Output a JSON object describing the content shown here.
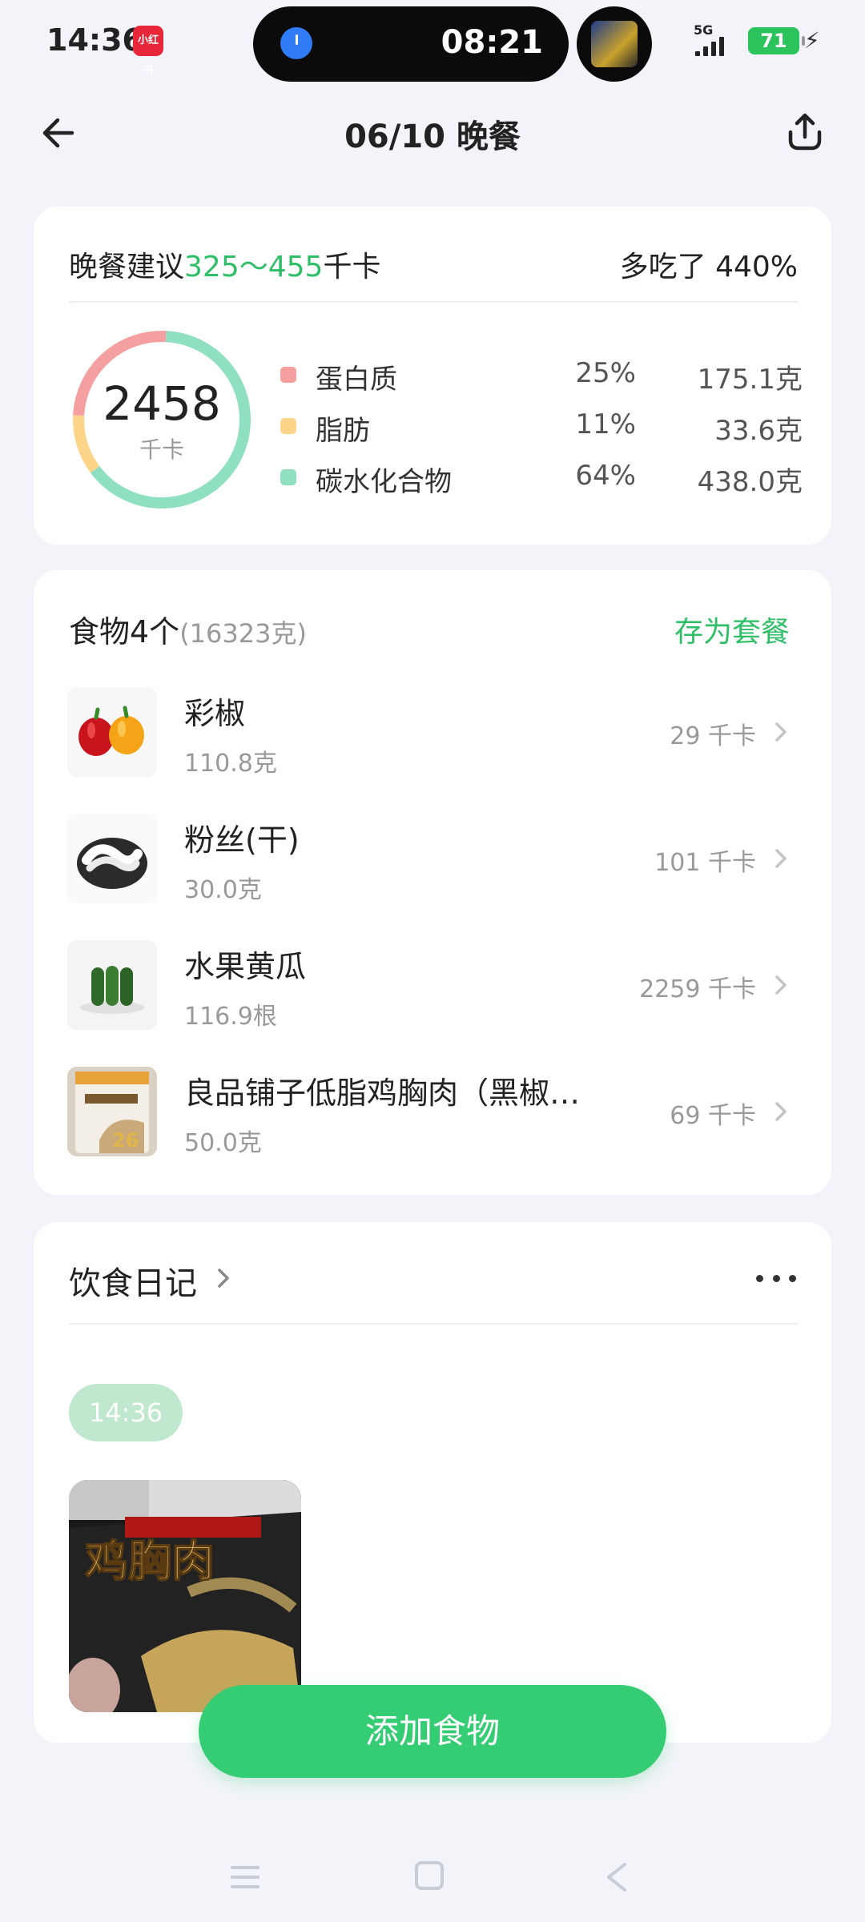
{
  "status_bar": {
    "time": "14:36",
    "app_badge": "小红书",
    "timer": "08:21",
    "network": "5G",
    "battery": "71"
  },
  "header": {
    "title": "06/10 晚餐"
  },
  "summary": {
    "suggest_prefix": "晚餐建议",
    "suggest_range": "325～455",
    "suggest_unit": "千卡",
    "over_text": "多吃了 440%",
    "total_kcal": "2458",
    "kcal_unit": "千卡",
    "macros": [
      {
        "name": "蛋白质",
        "percent": "25%",
        "amount": "175.1克",
        "color": "#f5a0a0",
        "fraction": 0.25
      },
      {
        "name": "脂肪",
        "percent": "11%",
        "amount": "33.6克",
        "color": "#fcd58a",
        "fraction": 0.11
      },
      {
        "name": "碳水化合物",
        "percent": "64%",
        "amount": "438.0克",
        "color": "#8fe0c0",
        "fraction": 0.64
      }
    ]
  },
  "foods": {
    "title": "食物4个",
    "weight": "(16323克)",
    "save_label": "存为套餐",
    "items": [
      {
        "name": "彩椒",
        "amount": "110.8克",
        "kcal": "29 千卡",
        "icon": "bell-pepper-photo"
      },
      {
        "name": "粉丝(干)",
        "amount": "30.0克",
        "kcal": "101 千卡",
        "icon": "vermicelli-photo"
      },
      {
        "name": "水果黄瓜",
        "amount": "116.9根",
        "kcal": "2259 千卡",
        "icon": "cucumber-photo"
      },
      {
        "name": "良品铺子低脂鸡胸肉（黑椒…",
        "amount": "50.0克",
        "kcal": "69 千卡",
        "icon": "chicken-breast-pack-photo"
      }
    ]
  },
  "diary": {
    "title": "饮食日记",
    "time_chip": "14:36",
    "photo_text": "鸡胸肉"
  },
  "actions": {
    "add_food": "添加食物"
  }
}
